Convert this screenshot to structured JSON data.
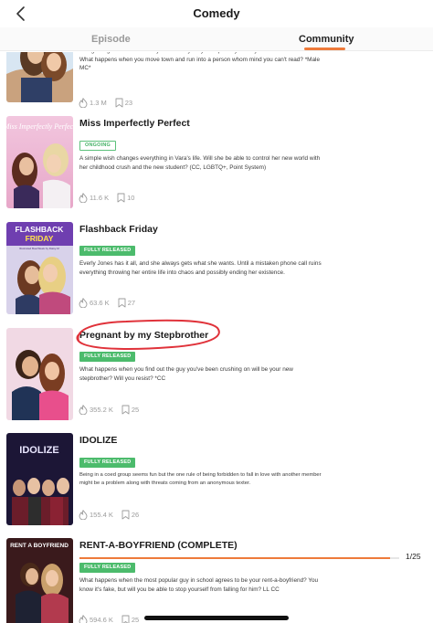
{
  "header": {
    "title": "Comedy"
  },
  "tabs": [
    {
      "label": "Episode"
    },
    {
      "label": "Community",
      "active": true
    }
  ],
  "stories": [
    {
      "title": "",
      "badge": "",
      "description": "Being in high school has always been easy for you especially since you're a friend reader. What happens when you move town and run into a person whom mind you can't read? *Male MC*",
      "views": "1.3 M",
      "episodes": "23"
    },
    {
      "title": "Miss Imperfectly Perfect",
      "cover_text": "Miss Imperfectly Perfect",
      "badge": "ONGOING",
      "description": "A simple wish changes everything in Vara's life. Will she be able to control her new world with her childhood crush and the new student? (CC, LGBTQ+, Point System)",
      "views": "11.6 K",
      "episodes": "10"
    },
    {
      "title": "Flashback Friday",
      "cover_text": "FLASHBACK FRIDAY",
      "cover_sub": "Illustrated BoerWeek by Daisy-M",
      "badge": "FULLY RELEASED",
      "description": "Everly Jones has it all, and she always gets what she wants. Until a mistaken phone call ruins everything throwing her entire life into chaos and possibly ending her existence.",
      "views": "63.6 K",
      "episodes": "27"
    },
    {
      "title": "Pregnant by my Stepbrother",
      "badge": "FULLY RELEASED",
      "description": "What happens when you find out the guy you've been crushing on will be your new stepbrother? Will you resist? *CC",
      "views": "355.2 K",
      "episodes": "25"
    },
    {
      "title": "IDOLIZE",
      "cover_text": "IDOLIZE",
      "badge": "FULLY RELEASED",
      "description": "Being in a coed group seems fun but the one rule of being forbidden to fall in love with another member might be a problem along with threats coming from an anonymous texter.",
      "views": "155.4 K",
      "episodes": "26"
    },
    {
      "title": "RENT-A-BOYFRIEND (COMPLETE)",
      "cover_text": "RENT A BOYFRIEND",
      "badge": "FULLY RELEASED",
      "description": "What happens when the most popular guy in school agrees to be your rent-a-boyfriend? You know it's fake, but will you be able to stop yourself from falling for him? LL CC",
      "views": "594.6 K",
      "episodes": "25"
    }
  ],
  "pager": {
    "text": "1/25",
    "progress": 0.97
  },
  "colors": {
    "accent": "#ee7a3a",
    "released": "#4cbb6c",
    "annotation": "#e0323a"
  },
  "icons": [
    "back-chevron-icon",
    "flame-icon",
    "bookmark-icon"
  ]
}
